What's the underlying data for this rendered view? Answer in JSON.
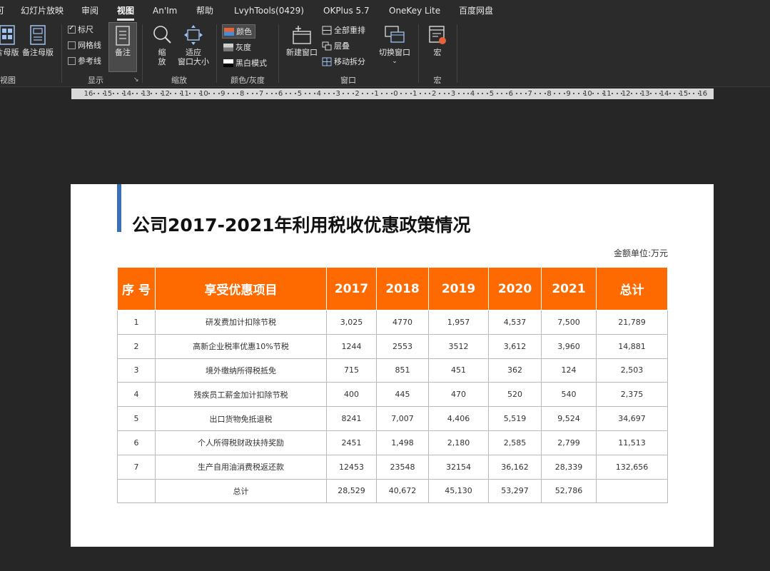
{
  "tabs": [
    {
      "label": "可",
      "active": false
    },
    {
      "label": "幻灯片放映",
      "active": false
    },
    {
      "label": "审阅",
      "active": false
    },
    {
      "label": "视图",
      "active": true
    },
    {
      "label": "An'Im",
      "active": false
    },
    {
      "label": "帮助",
      "active": false
    },
    {
      "label": "LvyhTools(0429)",
      "active": false
    },
    {
      "label": "OKPlus 5.7",
      "active": false
    },
    {
      "label": "OneKey Lite",
      "active": false
    },
    {
      "label": "百度网盘",
      "active": false
    }
  ],
  "ribbon": {
    "views": {
      "slide_master": "片母版",
      "notes_master": "备注母版",
      "group_label": "视图"
    },
    "show": {
      "ruler": {
        "label": "标尺",
        "checked": true
      },
      "gridlines": {
        "label": "网格线",
        "checked": false
      },
      "guides": {
        "label": "参考线",
        "checked": false
      },
      "notes": "备注",
      "group_label": "显示"
    },
    "zoom": {
      "zoom_line1": "缩",
      "zoom_line2": "放",
      "fit_line1": "适应",
      "fit_line2": "窗口大小",
      "group_label": "缩放"
    },
    "color": {
      "color": "颜色",
      "grayscale": "灰度",
      "bw": "黑白模式",
      "group_label": "颜色/灰度"
    },
    "window": {
      "new_window": "新建窗口",
      "arrange_all": "全部重排",
      "cascade": "层叠",
      "move_split": "移动拆分",
      "switch_windows": "切换窗口",
      "group_label": "窗口"
    },
    "macros": {
      "macro": "宏",
      "group_label": "宏"
    }
  },
  "ruler_labels": [
    "16",
    "15",
    "14",
    "13",
    "12",
    "11",
    "10",
    "9",
    "8",
    "7",
    "6",
    "5",
    "4",
    "3",
    "2",
    "1",
    "0",
    "1",
    "2",
    "3",
    "4",
    "5",
    "6",
    "7",
    "8",
    "9",
    "10",
    "11",
    "12",
    "13",
    "14",
    "15",
    "16"
  ],
  "slide": {
    "title": "公司2017-2021年利用税收优惠政策情况",
    "unit_note": "金额单位:万元",
    "header_color": "#ff6a00",
    "accent_color": "#3b6fb6",
    "table": {
      "headers": [
        "序 号",
        "享受优惠项目",
        "2017",
        "2018",
        "2019",
        "2020",
        "2021",
        "总计"
      ],
      "rows": [
        [
          "1",
          "研发费加计扣除节税",
          "3,025",
          "4770",
          "1,957",
          "4,537",
          "7,500",
          "21,789"
        ],
        [
          "2",
          "高新企业税率优惠10%节税",
          "1244",
          "2553",
          "3512",
          "3,612",
          "3,960",
          "14,881"
        ],
        [
          "3",
          "境外缴纳所得税抵免",
          "715",
          "851",
          "451",
          "362",
          "124",
          "2,503"
        ],
        [
          "4",
          "残疾员工薪金加计扣除节税",
          "400",
          "445",
          "470",
          "520",
          "540",
          "2,375"
        ],
        [
          "5",
          "出口货物免抵退税",
          "8241",
          "7,007",
          "4,406",
          "5,519",
          "9,524",
          "34,697"
        ],
        [
          "6",
          "个人所得税财政扶持奖励",
          "2451",
          "1,498",
          "2,180",
          "2,585",
          "2,799",
          "11,513"
        ],
        [
          "7",
          "生产自用油消费税返还款",
          "12453",
          "23548",
          "32154",
          "36,162",
          "28,339",
          "132,656"
        ],
        [
          "",
          "总计",
          "28,529",
          "40,672",
          "45,130",
          "53,297",
          "52,786",
          ""
        ]
      ]
    }
  }
}
